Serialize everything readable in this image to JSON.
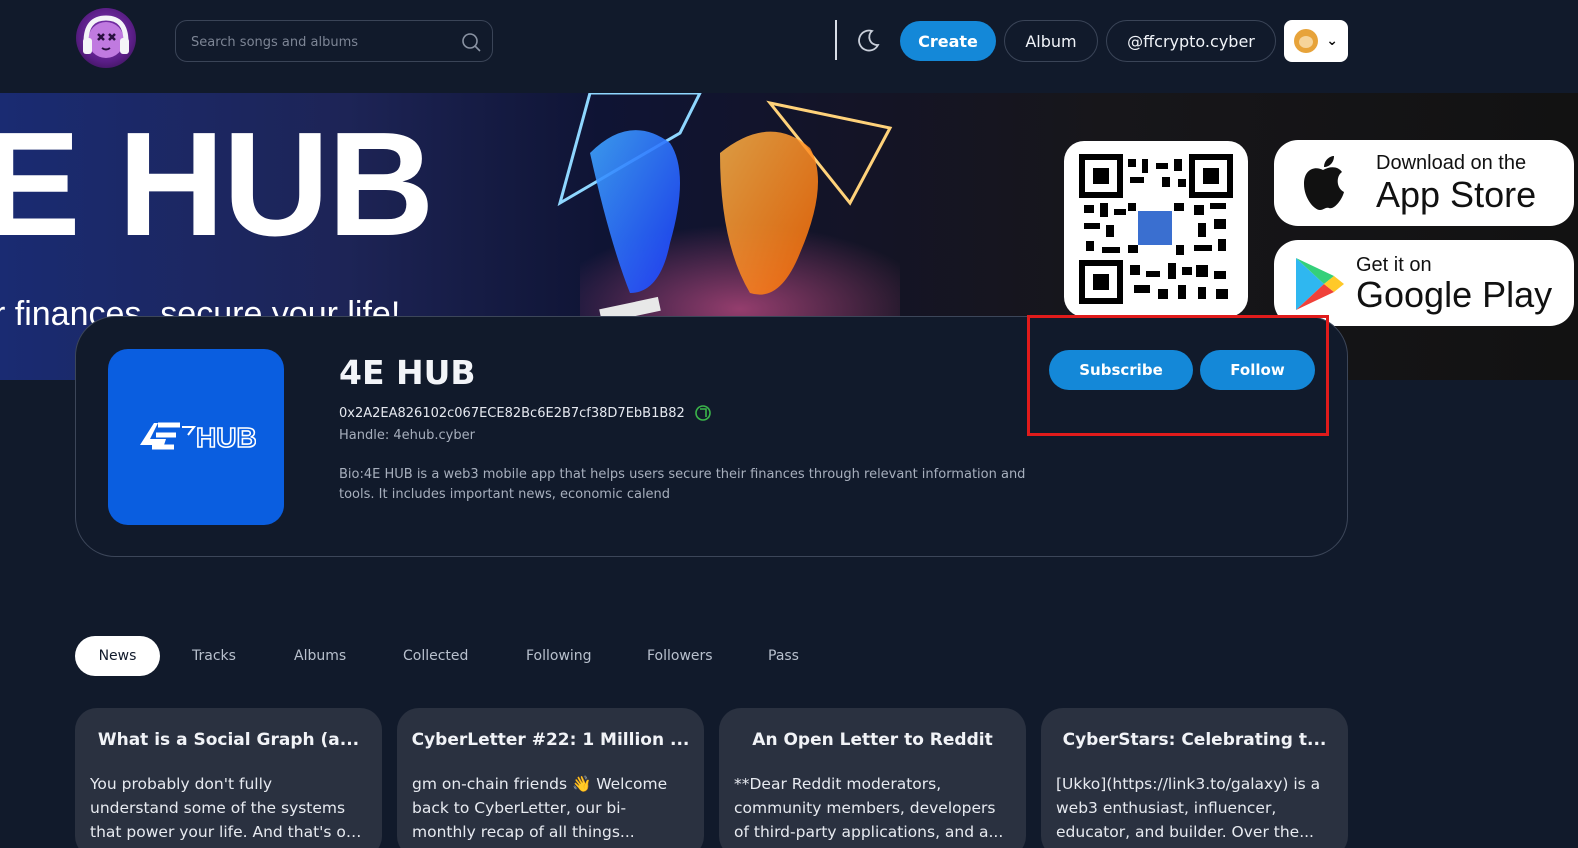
{
  "nav": {
    "search_placeholder": "Search songs and albums",
    "create_label": "Create",
    "album_label": "Album",
    "handle_label": "@ffcrypto.cyber"
  },
  "banner": {
    "title": "E HUB",
    "subtitle": "r finances, secure your life!",
    "app_store": {
      "line1": "Download on the",
      "line2": "App Store"
    },
    "google_play": {
      "line1": "Get it on",
      "line2": "Google Play"
    }
  },
  "profile": {
    "name": "4E HUB",
    "address": "0x2A2EA826102c067ECE82Bc6E2B7cf38D7EbB1B82",
    "handle": "Handle: 4ehub.cyber",
    "bio": "Bio:4E HUB is a web3 mobile app that helps users secure their finances through relevant information and tools. It includes important news, economic calend",
    "subscribe_label": "Subscribe",
    "follow_label": "Follow"
  },
  "tabs": [
    {
      "label": "News",
      "active": true
    },
    {
      "label": "Tracks"
    },
    {
      "label": "Albums"
    },
    {
      "label": "Collected"
    },
    {
      "label": "Following"
    },
    {
      "label": "Followers"
    },
    {
      "label": "Pass"
    }
  ],
  "cards": [
    {
      "title": "What is a Social Graph (a...",
      "lines": [
        "You probably don't fully",
        "understand some of the systems",
        "that power your life. And that's ok..."
      ]
    },
    {
      "title": "CyberLetter #22: 1 Million ...",
      "lines": [
        "gm on-chain friends 👋 Welcome",
        "back to CyberLetter, our bi-",
        "monthly recap of all things..."
      ]
    },
    {
      "title": "An Open Letter to Reddit",
      "lines": [
        "**Dear Reddit moderators,",
        "community members, developers",
        "of third-party applications, and a..."
      ]
    },
    {
      "title": "CyberStars: Celebrating t...",
      "lines": [
        "[Ukko](https://link3.to/galaxy) is a",
        "web3 enthusiast, influencer,",
        "educator, and builder. Over the..."
      ]
    }
  ],
  "colors": {
    "accent": "#1488d8",
    "background": "#111a2b",
    "card": "#2a3140",
    "highlight": "#e01b1b"
  }
}
